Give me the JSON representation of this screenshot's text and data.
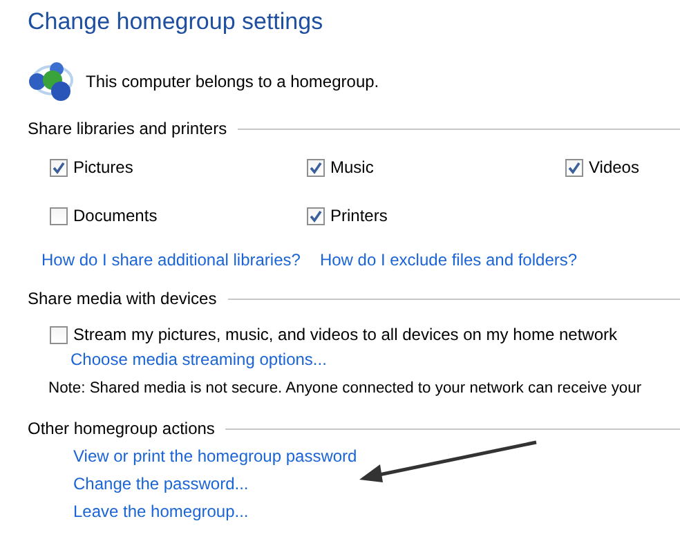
{
  "title": "Change homegroup settings",
  "status": "This computer belongs to a homegroup.",
  "sections": [
    {
      "heading": "Share libraries and printers",
      "checkboxes": [
        {
          "label": "Pictures",
          "checked": true
        },
        {
          "label": "Music",
          "checked": true
        },
        {
          "label": "Videos",
          "checked": true
        },
        {
          "label": "Documents",
          "checked": false
        },
        {
          "label": "Printers",
          "checked": true
        }
      ],
      "links": [
        "How do I share additional libraries?",
        "How do I exclude files and folders?"
      ]
    },
    {
      "heading": "Share media with devices",
      "checkboxes": [
        {
          "label": "Stream my pictures, music, and videos to all devices on my home network",
          "checked": false
        }
      ],
      "links": [
        "Choose media streaming options..."
      ],
      "note": "Note: Shared media is not secure. Anyone connected to your network can receive your"
    },
    {
      "heading": "Other homegroup actions",
      "links": [
        "View or print the homegroup password",
        "Change the password...",
        "Leave the homegroup..."
      ]
    }
  ]
}
